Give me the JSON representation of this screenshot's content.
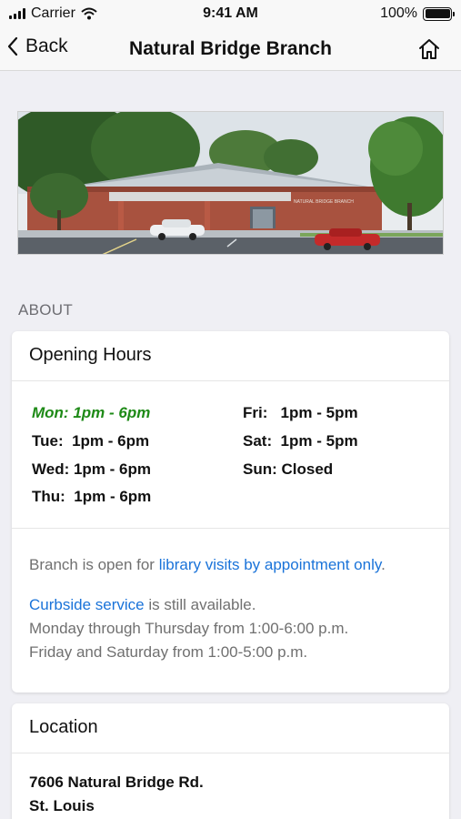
{
  "status_bar": {
    "carrier": "Carrier",
    "time": "9:41 AM",
    "battery": "100%"
  },
  "nav": {
    "back_label": "Back",
    "title": "Natural Bridge Branch"
  },
  "photo": {
    "sign_text": "NATURAL BRIDGE BRANCH"
  },
  "section": {
    "about": "ABOUT"
  },
  "hours_card": {
    "title": "Opening Hours",
    "today_color": "#1e8a17",
    "left": [
      {
        "text": "Mon: 1pm - 6pm",
        "today": true
      },
      {
        "text": "Tue:  1pm - 6pm"
      },
      {
        "text": "Wed: 1pm - 6pm"
      },
      {
        "text": "Thu:  1pm - 6pm"
      }
    ],
    "right": [
      {
        "text": "Fri:   1pm - 5pm"
      },
      {
        "text": "Sat:  1pm - 5pm"
      },
      {
        "text": "Sun: Closed"
      }
    ],
    "notes": {
      "line1_pre": "Branch is open for ",
      "line1_link": "library visits by appointment only",
      "line1_post": ".",
      "curbside_link": "Curbside service",
      "curbside_post": " is still available.",
      "line3": "Monday through Thursday from 1:00-6:00 p.m.",
      "line4": "Friday and Saturday from 1:00-5:00 p.m."
    }
  },
  "location_card": {
    "title": "Location",
    "address_line1": "7606 Natural Bridge Rd.",
    "address_line2": "St. Louis"
  },
  "colors": {
    "link": "#1a73d9",
    "background": "#efeff4"
  }
}
